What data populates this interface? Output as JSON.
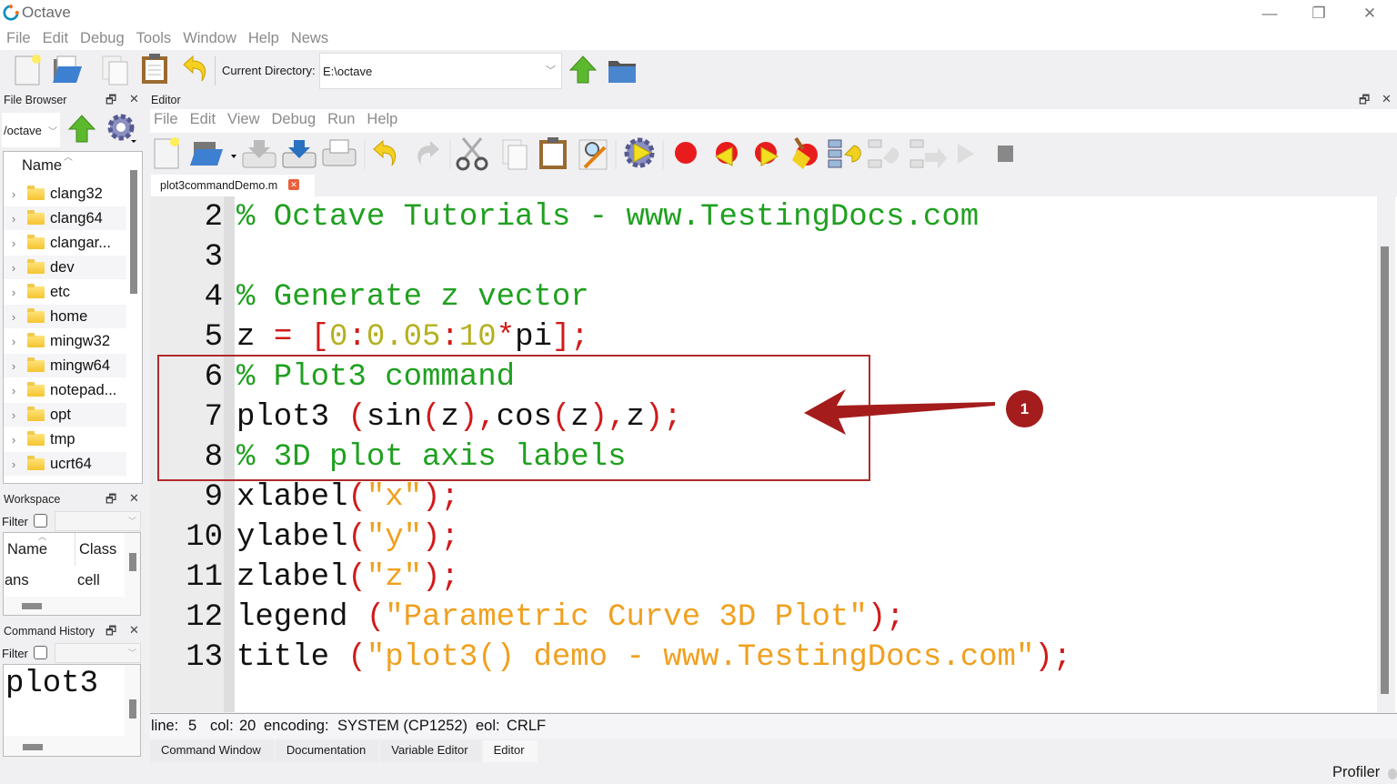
{
  "window": {
    "title": "Octave",
    "minimize_icon": "minimize-icon",
    "restore_icon": "restore-icon",
    "close_icon": "close-icon"
  },
  "main_menu": [
    "File",
    "Edit",
    "Debug",
    "Tools",
    "Window",
    "Help",
    "News"
  ],
  "main_toolbar": {
    "icons": [
      "new-script-icon",
      "open-folder-icon",
      "copy-icon",
      "paste-icon",
      "undo-icon"
    ],
    "current_directory_label": "Current Directory:",
    "current_directory_value": "E:\\octave",
    "after_icons": [
      "parent-directory-icon",
      "browse-directory-icon"
    ]
  },
  "file_browser": {
    "title": "File Browser",
    "path": "/octave",
    "column_header": "Name",
    "items": [
      "clang32",
      "clang64",
      "clangar...",
      "dev",
      "etc",
      "home",
      "mingw32",
      "mingw64",
      "notepad...",
      "opt",
      "tmp",
      "ucrt64"
    ]
  },
  "workspace": {
    "title": "Workspace",
    "filter_label": "Filter",
    "columns": [
      "Name",
      "Class"
    ],
    "rows": [
      [
        "ans",
        "cell"
      ]
    ]
  },
  "command_history": {
    "title": "Command History",
    "filter_label": "Filter",
    "entries": [
      "plot3"
    ]
  },
  "editor": {
    "title": "Editor",
    "menu": [
      "File",
      "Edit",
      "View",
      "Debug",
      "Run",
      "Help"
    ],
    "toolbar_icons": [
      "new-file-icon",
      "open-file-icon",
      "save-icon",
      "save-as-icon",
      "print-icon",
      "undo-icon",
      "redo-icon",
      "cut-icon",
      "copy-icon",
      "paste-icon",
      "find-replace-icon",
      "run-icon",
      "toggle-breakpoint-icon",
      "previous-breakpoint-icon",
      "next-breakpoint-icon",
      "clear-breakpoints-icon",
      "step-in-icon",
      "step-over-icon",
      "step-out-icon",
      "continue-icon",
      "stop-icon"
    ],
    "tab": "plot3commandDemo.m",
    "lines": [
      {
        "n": "2",
        "tokens": [
          [
            "com",
            "% Octave Tutorials - www.TestingDocs.com"
          ]
        ]
      },
      {
        "n": "3",
        "tokens": []
      },
      {
        "n": "4",
        "tokens": [
          [
            "com",
            "% Generate z vector"
          ]
        ]
      },
      {
        "n": "5",
        "tokens": [
          [
            "txt",
            "z "
          ],
          [
            "op",
            "="
          ],
          [
            "txt",
            " "
          ],
          [
            "op",
            "["
          ],
          [
            "num",
            "0"
          ],
          [
            "op",
            ":"
          ],
          [
            "num",
            "0.05"
          ],
          [
            "op",
            ":"
          ],
          [
            "num",
            "10"
          ],
          [
            "op",
            "*"
          ],
          [
            "txt",
            "pi"
          ],
          [
            "op",
            "];"
          ]
        ]
      },
      {
        "n": "6",
        "tokens": [
          [
            "com",
            "% Plot3 command"
          ]
        ]
      },
      {
        "n": "7",
        "tokens": [
          [
            "txt",
            "plot3 "
          ],
          [
            "op",
            "("
          ],
          [
            "txt",
            "sin"
          ],
          [
            "op",
            "("
          ],
          [
            "txt",
            "z"
          ],
          [
            "op",
            "),"
          ],
          [
            "txt",
            "cos"
          ],
          [
            "op",
            "("
          ],
          [
            "txt",
            "z"
          ],
          [
            "op",
            "),"
          ],
          [
            "txt",
            "z"
          ],
          [
            "op",
            ");"
          ]
        ]
      },
      {
        "n": "8",
        "tokens": [
          [
            "com",
            "% 3D plot axis labels"
          ]
        ]
      },
      {
        "n": "9",
        "tokens": [
          [
            "txt",
            "xlabel"
          ],
          [
            "op",
            "("
          ],
          [
            "str",
            "\"x\""
          ],
          [
            "op",
            ");"
          ]
        ]
      },
      {
        "n": "10",
        "tokens": [
          [
            "txt",
            "ylabel"
          ],
          [
            "op",
            "("
          ],
          [
            "str",
            "\"y\""
          ],
          [
            "op",
            ");"
          ]
        ]
      },
      {
        "n": "11",
        "tokens": [
          [
            "txt",
            "zlabel"
          ],
          [
            "op",
            "("
          ],
          [
            "str",
            "\"z\""
          ],
          [
            "op",
            ");"
          ]
        ]
      },
      {
        "n": "12",
        "tokens": [
          [
            "txt",
            "legend "
          ],
          [
            "op",
            "("
          ],
          [
            "str",
            "\"Parametric Curve 3D Plot\""
          ],
          [
            "op",
            ");"
          ]
        ]
      },
      {
        "n": "13",
        "tokens": [
          [
            "txt",
            "title "
          ],
          [
            "op",
            "("
          ],
          [
            "str",
            "\"plot3() demo - www.TestingDocs.com\""
          ],
          [
            "op",
            ");"
          ]
        ]
      }
    ],
    "annotation_badge": "1"
  },
  "status_bar": {
    "line_label": "line:",
    "line_value": "5",
    "col_label": "col:",
    "col_value": "20",
    "encoding_label": "encoding:",
    "encoding_value": "SYSTEM (CP1252)",
    "eol_label": "eol:",
    "eol_value": "CRLF"
  },
  "bottom_tabs": [
    "Command Window",
    "Documentation",
    "Variable Editor",
    "Editor"
  ],
  "active_bottom_tab": "Editor",
  "profiler_label": "Profiler",
  "colors": {
    "comment": "#20a020",
    "operator": "#d11a1a",
    "number": "#b5b020",
    "string": "#f0a020",
    "annotation": "#a51c1c"
  }
}
